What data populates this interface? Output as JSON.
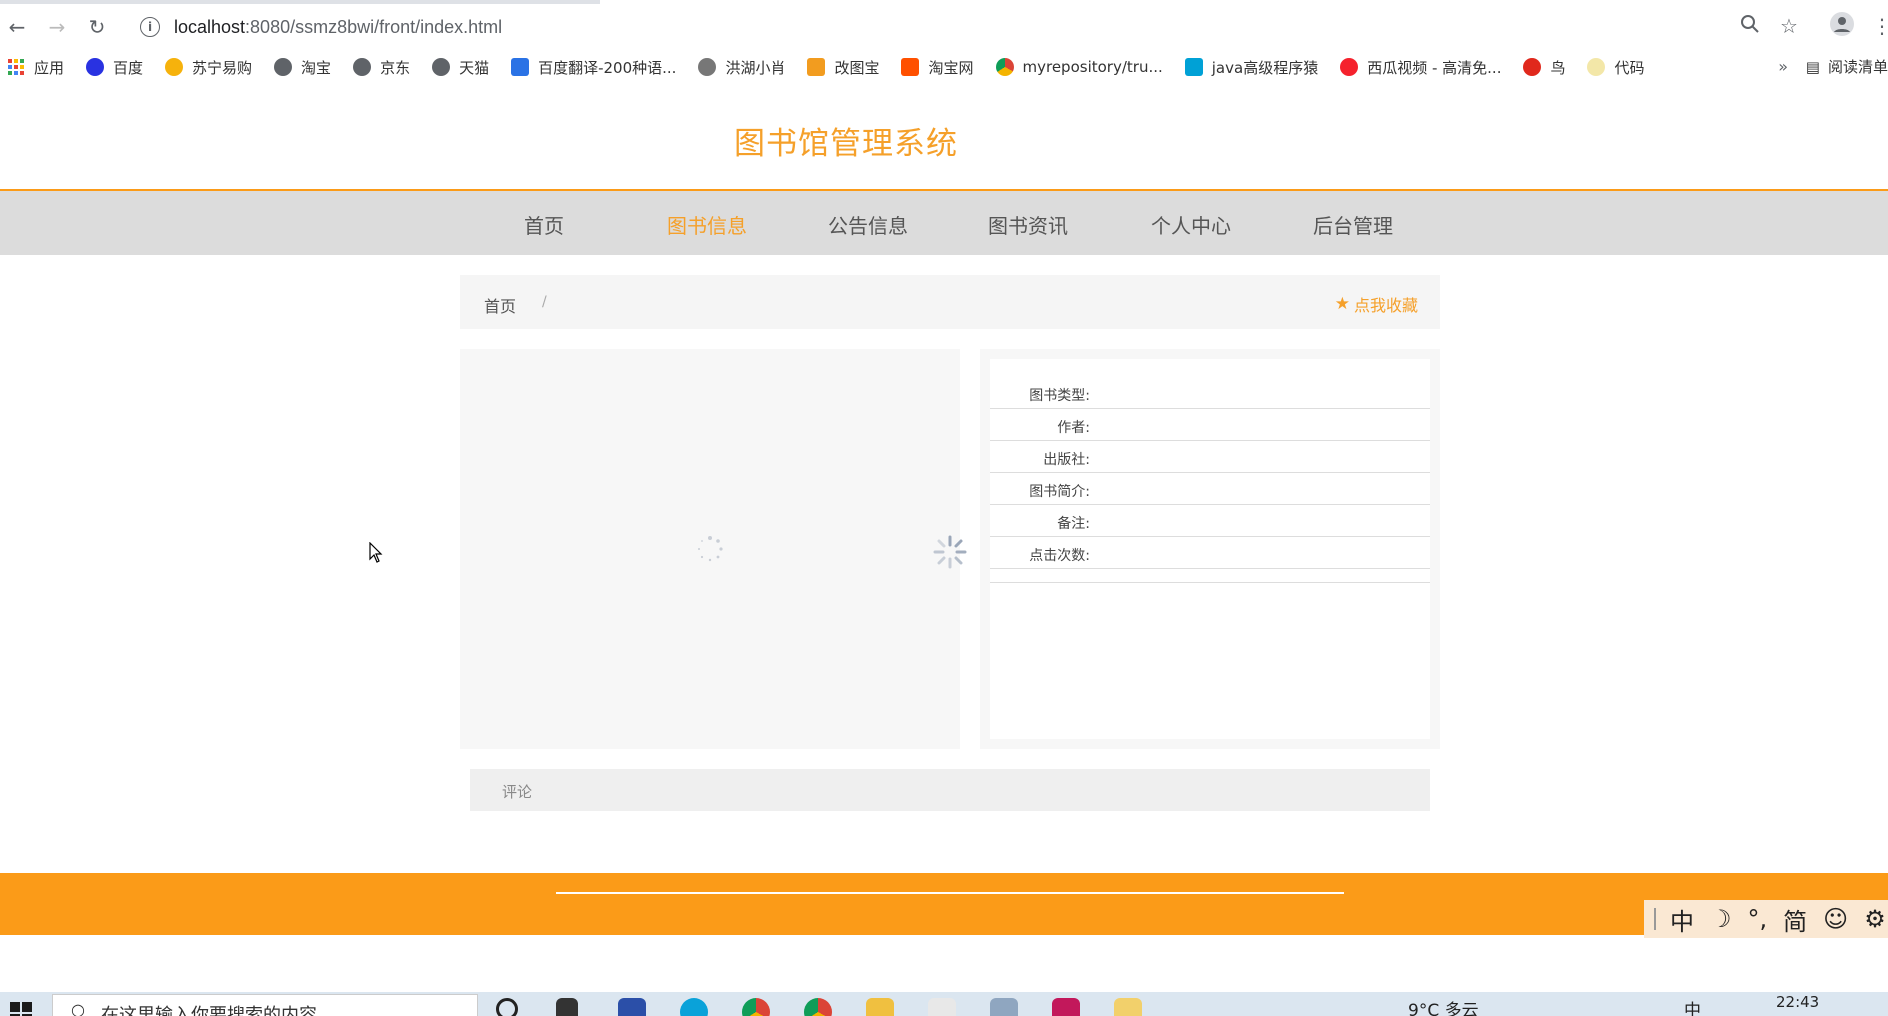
{
  "browser": {
    "url_host": "localhost",
    "url_rest": ":8080/ssmz8bwi/front/index.html",
    "bookmarks": [
      {
        "label": "应用",
        "color": "#e94235"
      },
      {
        "label": "百度",
        "color": "#2932e1"
      },
      {
        "label": "苏宁易购",
        "color": "#f6b20c"
      },
      {
        "label": "淘宝",
        "color": "#5f6368"
      },
      {
        "label": "京东",
        "color": "#5f6368"
      },
      {
        "label": "天猫",
        "color": "#5f6368"
      },
      {
        "label": "百度翻译-200种语...",
        "color": "#2a72e5"
      },
      {
        "label": "洪湖小肖",
        "color": "#777777"
      },
      {
        "label": "改图宝",
        "color": "#f29c1f"
      },
      {
        "label": "淘宝网",
        "color": "#ff5000"
      },
      {
        "label": "myrepository/tru...",
        "color": "#db4437"
      },
      {
        "label": "java高级程序猿",
        "color": "#00a1d6"
      },
      {
        "label": "西瓜视频 - 高清免...",
        "color": "#f5222d"
      },
      {
        "label": "鸟",
        "color": "#e0281c"
      },
      {
        "label": "代码",
        "color": "#f3e7a8"
      }
    ],
    "bookmarks_more": "»",
    "reading_list": "阅读清单"
  },
  "site": {
    "title": "图书馆管理系统",
    "nav": [
      "首页",
      "图书信息",
      "公告信息",
      "图书资讯",
      "个人中心",
      "后台管理"
    ],
    "active_nav": "图书信息"
  },
  "breadcrumb": {
    "home": "首页",
    "separator": "/",
    "favorite": "点我收藏"
  },
  "book_info": {
    "labels": [
      "图书类型:",
      "作者:",
      "出版社:",
      "图书简介:",
      "备注:",
      "点击次数:"
    ]
  },
  "comment": {
    "label": "评论"
  },
  "ime": {
    "items": [
      "中",
      "☽",
      "°,",
      "简",
      "☺",
      "⚙"
    ]
  },
  "taskbar": {
    "search_placeholder": "在这里输入你要搜索的内容",
    "weather": "9°C 多云",
    "input_lang": "中",
    "time": "22:43"
  },
  "colors": {
    "accent": "#fb9b18",
    "title": "#f5a02a",
    "navbar": "#dcdcdc"
  }
}
